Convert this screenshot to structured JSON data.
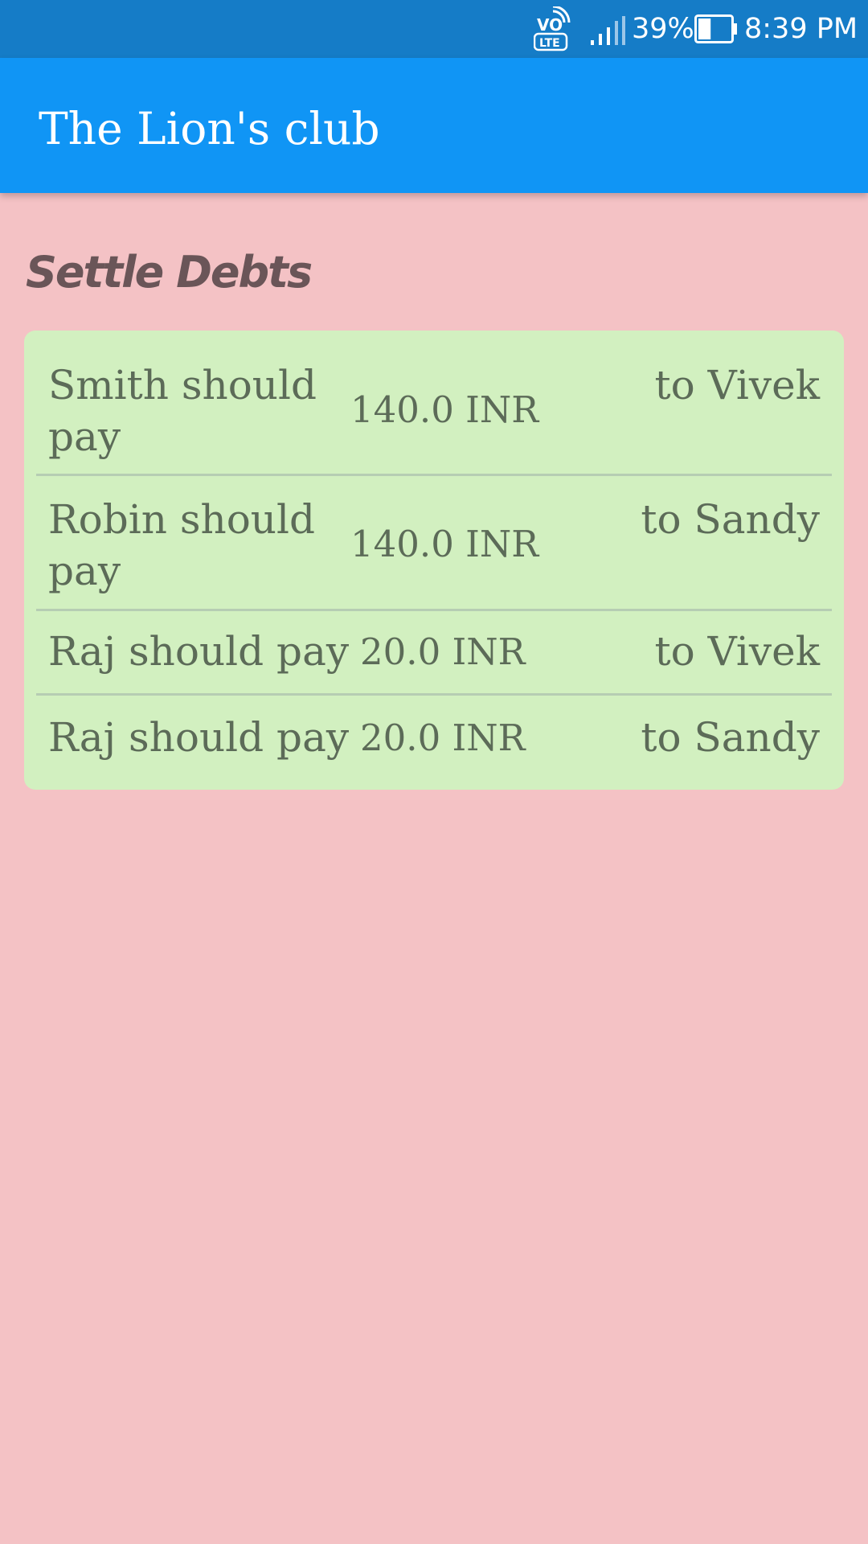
{
  "status_bar": {
    "network_badge_top": "VO",
    "network_badge_bottom": "LTE",
    "battery_percent": "39%",
    "time": "8:39 PM",
    "battery_level": 0.39,
    "icons": [
      "volte-icon",
      "signal-icon",
      "battery-icon"
    ],
    "background": "#157cc7"
  },
  "app_bar": {
    "title": "The Lion's club",
    "background": "#1095f5"
  },
  "screen": {
    "heading": "Settle Debts",
    "background": "#f4c2c5",
    "card_background": "#d2f0c0"
  },
  "debts": [
    {
      "payer": "Smith should pay",
      "amount": "140.0 INR",
      "payee": "to Vivek"
    },
    {
      "payer": "Robin should pay",
      "amount": "140.0 INR",
      "payee": "to Sandy"
    },
    {
      "payer": "Raj should pay",
      "amount": "20.0 INR",
      "payee": "to Vivek"
    },
    {
      "payer": "Raj should pay",
      "amount": "20.0 INR",
      "payee": "to Sandy"
    }
  ]
}
